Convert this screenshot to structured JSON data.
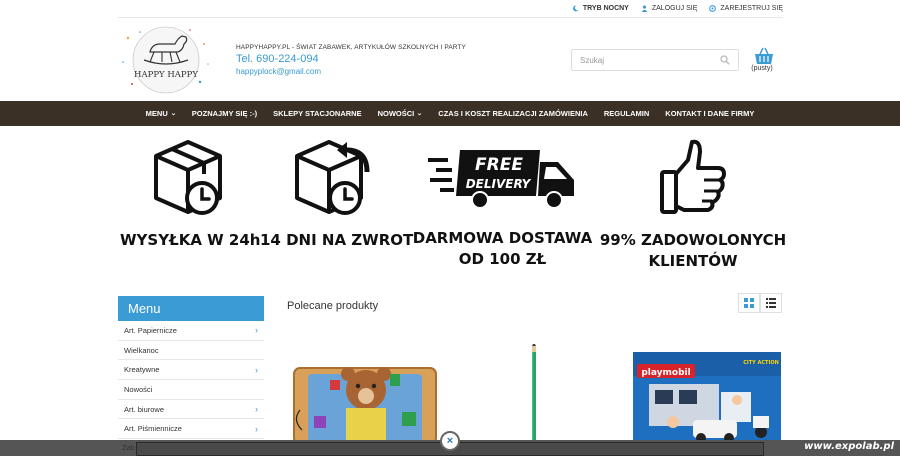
{
  "topbar": {
    "night_mode": "TRYB NOCNY",
    "login": "ZALOGUJ SIĘ",
    "register": "ZAREJESTRUJ SIĘ"
  },
  "header": {
    "logo_text": "HAPPY HAPPY",
    "tagline": "HAPPYHAPPY.PL - ŚWIAT ZABAWEK, ARTYKUŁÓW SZKOLNYCH I PARTY",
    "phone": "Tel. 690-224-094",
    "email": "happyplock@gmail.com",
    "search_placeholder": "Szukaj",
    "cart_label": "(pusty)"
  },
  "nav": {
    "items": [
      {
        "label": "MENU",
        "dropdown": true
      },
      {
        "label": "POZNAJMY SIĘ :-)",
        "dropdown": false
      },
      {
        "label": "SKLEPY STACJONARNE",
        "dropdown": false
      },
      {
        "label": "NOWOŚCI",
        "dropdown": true
      },
      {
        "label": "CZAS I KOSZT REALIZACJI ZAMÓWIENIA",
        "dropdown": false
      },
      {
        "label": "REGULAMIN",
        "dropdown": false
      },
      {
        "label": "KONTAKT I DANE FIRMY",
        "dropdown": false
      }
    ]
  },
  "features": {
    "shipping": "WYSYŁKA W 24h",
    "returns": "14 DNI NA ZWROT",
    "free_line1": "DARMOWA DOSTAWA",
    "free_line2": "OD 100 ZŁ",
    "truck_text1": "FREE",
    "truck_text2": "DELIVERY",
    "happy_line1": "99% ZADOWOLONYCH",
    "happy_line2": "KLIENTÓW"
  },
  "sidebar": {
    "title": "Menu",
    "items": [
      {
        "label": "Art. Papiernicze",
        "arrow": true
      },
      {
        "label": "Wielkanoc",
        "arrow": false
      },
      {
        "label": "Kreatywne",
        "arrow": true
      },
      {
        "label": "Nowości",
        "arrow": false
      },
      {
        "label": "Art. biurowe",
        "arrow": true
      },
      {
        "label": "Art. Piśmiennicze",
        "arrow": true
      }
    ],
    "partial_item": "Zab"
  },
  "products": {
    "heading": "Polecane produkty",
    "playmobil_brand": "playmobil",
    "playmobil_series": "CITY ACTION"
  },
  "overlay": {
    "watermark": "www.expolab.pl",
    "close_symbol": "×"
  },
  "colors": {
    "accent": "#3a9bd5",
    "nav_bg": "#3a3025"
  }
}
